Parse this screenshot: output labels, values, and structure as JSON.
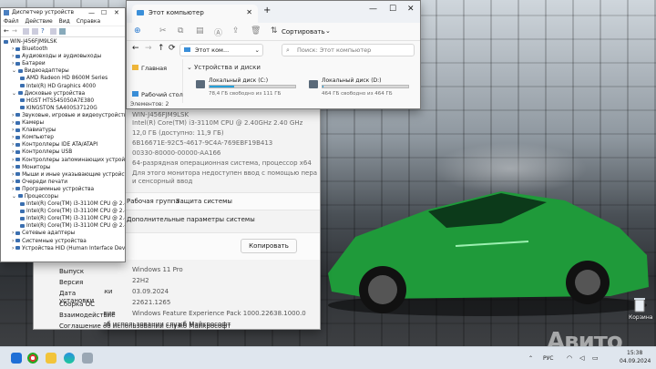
{
  "device_manager": {
    "title": "Диспетчер устройств",
    "menu": [
      "Файл",
      "Действие",
      "Вид",
      "Справка"
    ],
    "tree": [
      {
        "text": "WIN-J456FJM9LSK",
        "level": 0
      },
      {
        "text": "Bluetooth",
        "level": 1
      },
      {
        "text": "Аудиовходы и аудиовыходы",
        "level": 1
      },
      {
        "text": "Батареи",
        "level": 1
      },
      {
        "text": "Видеоадаптеры",
        "level": 1
      },
      {
        "text": "AMD Radeon HD 8600M Series",
        "level": 2
      },
      {
        "text": "Intel(R) HD Graphics 4000",
        "level": 2
      },
      {
        "text": "Дисковые устройства",
        "level": 1
      },
      {
        "text": "HGST HTS545050A7E380",
        "level": 2
      },
      {
        "text": "KINGSTON SA400S37120G",
        "level": 2
      },
      {
        "text": "Звуковые, игровые и видеоустройства",
        "level": 1
      },
      {
        "text": "Камеры",
        "level": 1
      },
      {
        "text": "Клавиатуры",
        "level": 1
      },
      {
        "text": "Компьютер",
        "level": 1
      },
      {
        "text": "Контроллеры IDE ATA/ATAPI",
        "level": 1
      },
      {
        "text": "Контроллеры USB",
        "level": 1
      },
      {
        "text": "Контроллеры запоминающих устройств",
        "level": 1
      },
      {
        "text": "Мониторы",
        "level": 1
      },
      {
        "text": "Мыши и иные указывающие устройства",
        "level": 1
      },
      {
        "text": "Очереди печати",
        "level": 1
      },
      {
        "text": "Программные устройства",
        "level": 1
      },
      {
        "text": "Процессоры",
        "level": 1
      },
      {
        "text": "Intel(R) Core(TM) i3-3110M CPU @ 2.40GHz",
        "level": 2
      },
      {
        "text": "Intel(R) Core(TM) i3-3110M CPU @ 2.40GHz",
        "level": 2
      },
      {
        "text": "Intel(R) Core(TM) i3-3110M CPU @ 2.40GHz",
        "level": 2
      },
      {
        "text": "Intel(R) Core(TM) i3-3110M CPU @ 2.40GHz",
        "level": 2
      },
      {
        "text": "Сетевые адаптеры",
        "level": 1
      },
      {
        "text": "Системные устройства",
        "level": 1
      },
      {
        "text": "Устройства HID (Human Interface Devices)",
        "level": 1
      }
    ]
  },
  "explorer": {
    "tab_title": "Этот компьютер",
    "sort_label": "Сортировать",
    "address": "Этот ком...",
    "search_placeholder": "Поиск: Этот компьютер",
    "nav_home": "Главная",
    "nav_desktop": "Рабочий стол",
    "section_title": "Устройства и диски",
    "drive_c_name": "Локальный диск (C:)",
    "drive_c_space": "78,4 ГБ свободно из 111 ГБ",
    "drive_c_used": 0.29,
    "drive_d_name": "Локальный диск (D:)",
    "drive_d_space": "464 ГБ свободно из 464 ГБ",
    "drive_d_used": 0.01,
    "status": "Элементов: 2"
  },
  "settings": {
    "device_name": "WIN-J456FJM9LSK",
    "processor": "Intel(R) Core(TM) i3-3110M CPU @ 2.40GHz   2.40 GHz",
    "ram": "12,0 ГБ (доступно: 11,9 ГБ)",
    "device_id": "6B16671E-92C5-4617-9C4A-769EBF19B413",
    "product_id": "00330-80000-00000-AA166",
    "system_type": "64-разрядная операционная система, процессор x64",
    "pen_touch_1": "Для этого монитора недоступен ввод с помощью пера",
    "pen_touch_2": "и сенсорный ввод",
    "link_workgroup": "Рабочая группа",
    "link_protection": "Защита системы",
    "link_advanced": "Дополнительные параметры системы",
    "copy_button": "Копировать",
    "spec_rows": [
      {
        "label": "Выпуск",
        "value": "Windows 11 Pro"
      },
      {
        "label": "Версия",
        "value": "22H2"
      },
      {
        "label": "Дата установки",
        "value": "03.09.2024"
      },
      {
        "label": "Сборка ОС",
        "value": "22621.1265"
      },
      {
        "label": "Взаимодействие",
        "value": "Windows Feature Experience Pack 1000.22638.1000.0"
      },
      {
        "label": "Соглашение об использовании служб Майкрософт",
        "value": ""
      }
    ]
  },
  "desktop": {
    "recycle_bin": "Корзина",
    "watermark": "Авито"
  },
  "taskbar": {
    "language": "РУС",
    "time": "15:38",
    "date": "04.09.2024"
  },
  "colors": {
    "accent": "#26a0da",
    "car_green": "#1f9a3a"
  }
}
